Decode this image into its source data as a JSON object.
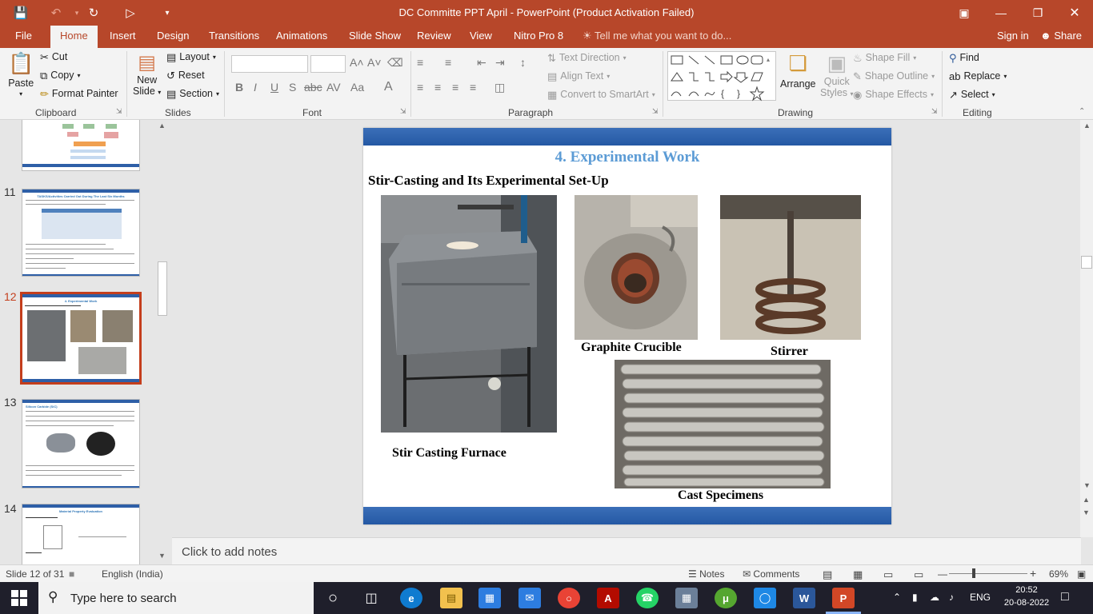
{
  "window": {
    "title": "DC Committe PPT April - PowerPoint (Product Activation Failed)"
  },
  "ribbon_tabs": [
    "File",
    "Home",
    "Insert",
    "Design",
    "Transitions",
    "Animations",
    "Slide Show",
    "Review",
    "View",
    "Nitro Pro 8"
  ],
  "tell_me": "Tell me what you want to do...",
  "sign_in": "Sign in",
  "share": "Share",
  "ribbon": {
    "clipboard": {
      "label": "Clipboard",
      "paste": "Paste",
      "cut": "Cut",
      "copy": "Copy",
      "format_painter": "Format Painter"
    },
    "slides": {
      "label": "Slides",
      "new_slide_1": "New",
      "new_slide_2": "Slide",
      "layout": "Layout",
      "reset": "Reset",
      "section": "Section"
    },
    "font": {
      "label": "Font"
    },
    "paragraph": {
      "label": "Paragraph",
      "text_direction": "Text Direction",
      "align_text": "Align Text",
      "convert_smartart": "Convert to SmartArt"
    },
    "drawing": {
      "label": "Drawing",
      "arrange": "Arrange",
      "quick_styles_1": "Quick",
      "quick_styles_2": "Styles",
      "shape_fill": "Shape Fill",
      "shape_outline": "Shape Outline",
      "shape_effects": "Shape Effects"
    },
    "editing": {
      "label": "Editing",
      "find": "Find",
      "replace": "Replace",
      "select": "Select"
    }
  },
  "thumbnails": [
    {
      "number": "11",
      "title": "TASKS/Activities Carried Out During The Last Six Months"
    },
    {
      "number": "12",
      "title": "4. Experimental Work"
    },
    {
      "number": "13",
      "title": "Silicon Carbide (SiC)"
    },
    {
      "number": "14",
      "title": "Material Property Evaluation"
    }
  ],
  "slide": {
    "title": "4. Experimental Work",
    "subtitle": "Stir-Casting and Its Experimental Set-Up",
    "captions": {
      "furnace": "Stir Casting Furnace",
      "crucible": "Graphite Crucible",
      "stirrer": "Stirrer",
      "specimens": "Cast Specimens"
    }
  },
  "notes_placeholder": "Click to add notes",
  "status": {
    "slide_info": "Slide 12 of 31",
    "language": "English (India)",
    "notes": "Notes",
    "comments": "Comments",
    "zoom": "69%"
  },
  "taskbar": {
    "search": "Type here to search",
    "lang": "ENG",
    "time": "20:52",
    "date": "20-08-2022"
  }
}
